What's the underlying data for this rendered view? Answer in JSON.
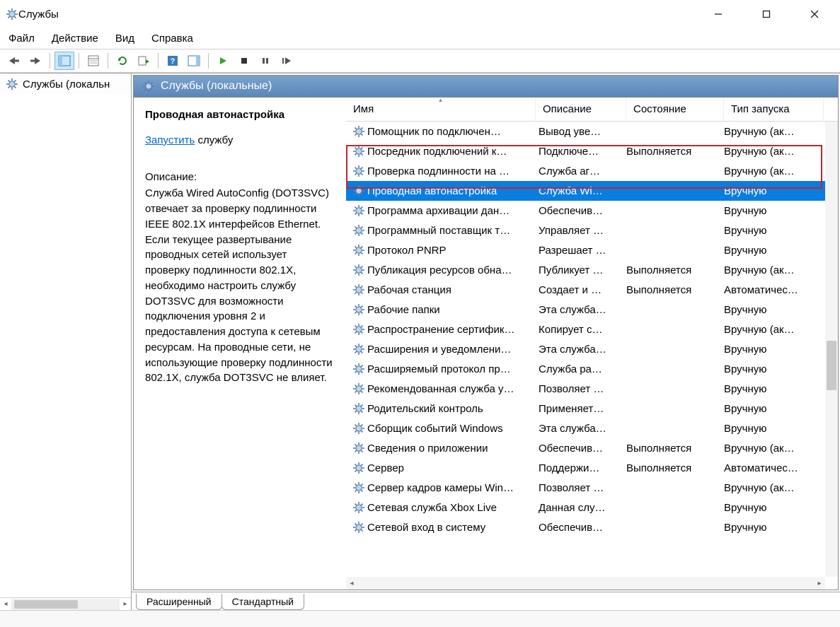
{
  "window": {
    "title": "Службы"
  },
  "menu": {
    "file": "Файл",
    "action": "Действие",
    "view": "Вид",
    "help": "Справка"
  },
  "tree": {
    "node": "Службы (локальн"
  },
  "pane_header": "Службы (локальные)",
  "detail": {
    "name": "Проводная автонастройка",
    "start_link": "Запустить",
    "start_suffix": " службу",
    "desc_label": "Описание:",
    "desc_text": "Служба Wired AutoConfig (DOT3SVC) отвечает за проверку подлинности IEEE 802.1X интерфейсов Ethernet. Если текущее развертывание проводных сетей использует проверку подлинности 802.1X, необходимо настроить службу DOT3SVC для возможности подключения уровня 2 и предоставления доступа к сетевым ресурсам. На проводные сети, не использующие проверку подлинности 802.1X, служба DOT3SVC не влияет."
  },
  "columns": {
    "name": "Имя",
    "desc": "Описание",
    "state": "Состояние",
    "startup": "Тип запуска"
  },
  "services": [
    {
      "name": "Помощник по подключен…",
      "desc": "Вывод уве…",
      "state": "",
      "startup": "Вручную (ак…"
    },
    {
      "name": "Посредник подключений к…",
      "desc": "Подключе…",
      "state": "Выполняется",
      "startup": "Вручную (ак…"
    },
    {
      "name": "Проверка подлинности на …",
      "desc": "Служба аг…",
      "state": "",
      "startup": "Вручную (ак…",
      "boxed_top": true
    },
    {
      "name": "Проводная автонастройка",
      "desc": "Служба Wi…",
      "state": "",
      "startup": "Вручную",
      "selected": true
    },
    {
      "name": "Программа архивации дан…",
      "desc": "Обеспечив…",
      "state": "",
      "startup": "Вручную",
      "boxed_bottom": true
    },
    {
      "name": "Программный поставщик т…",
      "desc": "Управляет …",
      "state": "",
      "startup": "Вручную"
    },
    {
      "name": "Протокол PNRP",
      "desc": "Разрешает …",
      "state": "",
      "startup": "Вручную"
    },
    {
      "name": "Публикация ресурсов обна…",
      "desc": "Публикует …",
      "state": "Выполняется",
      "startup": "Вручную (ак…"
    },
    {
      "name": "Рабочая станция",
      "desc": "Создает и …",
      "state": "Выполняется",
      "startup": "Автоматичес…"
    },
    {
      "name": "Рабочие папки",
      "desc": "Эта служба…",
      "state": "",
      "startup": "Вручную"
    },
    {
      "name": "Распространение сертифик…",
      "desc": "Копирует с…",
      "state": "",
      "startup": "Вручную (ак…"
    },
    {
      "name": "Расширения и уведомлени…",
      "desc": "Эта служба…",
      "state": "",
      "startup": "Вручную"
    },
    {
      "name": "Расширяемый протокол пр…",
      "desc": "Служба ра…",
      "state": "",
      "startup": "Вручную"
    },
    {
      "name": "Рекомендованная служба у…",
      "desc": "Позволяет …",
      "state": "",
      "startup": "Вручную"
    },
    {
      "name": "Родительский контроль",
      "desc": "Применяет…",
      "state": "",
      "startup": "Вручную"
    },
    {
      "name": "Сборщик событий Windows",
      "desc": "Эта служба…",
      "state": "",
      "startup": "Вручную"
    },
    {
      "name": "Сведения о приложении",
      "desc": "Обеспечив…",
      "state": "Выполняется",
      "startup": "Вручную (ак…"
    },
    {
      "name": "Сервер",
      "desc": "Поддержи…",
      "state": "Выполняется",
      "startup": "Автоматичес…"
    },
    {
      "name": "Сервер кадров камеры Win…",
      "desc": "Позволяет …",
      "state": "",
      "startup": "Вручную (ак…"
    },
    {
      "name": "Сетевая служба Xbox Live",
      "desc": "Данная слу…",
      "state": "",
      "startup": "Вручную"
    },
    {
      "name": "Сетевой вход в систему",
      "desc": "Обеспечив…",
      "state": "",
      "startup": "Вручную"
    }
  ],
  "tabs": {
    "extended": "Расширенный",
    "standard": "Стандартный"
  }
}
